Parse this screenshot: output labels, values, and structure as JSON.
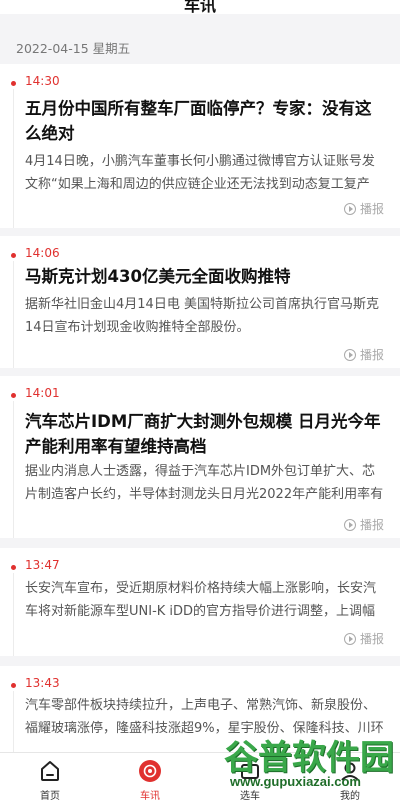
{
  "header": {
    "title": "车讯"
  },
  "date_label": "2022-04-15 星期五",
  "share_label": "播报",
  "news": [
    {
      "time": "14:30",
      "headline": "五月份中国所有整车厂面临停产？专家：没有这么绝对",
      "summary": "4月14日晚，小鹏汽车董事长何小鹏通过微博官方认证账号发文称“如果上海和周边的供应链企业还无法找到动态复工复产"
    },
    {
      "time": "14:06",
      "headline": "马斯克计划430亿美元全面收购推特",
      "summary": "据新华社旧金山4月14日电 美国特斯拉公司首席执行官马斯克14日宣布计划现金收购推特全部股份。"
    },
    {
      "time": "14:01",
      "headline": "汽车芯片IDM厂商扩大封测外包规模 日月光今年产能利用率有望维持高档",
      "summary": "据业内消息人士透露，得益于汽车芯片IDM外包订单扩大、芯片制造客户长约，半导体封测龙头日月光2022年产能利用率有"
    },
    {
      "time": "13:47",
      "headline": "",
      "summary": "长安汽车宣布，受近期原材料价格持续大幅上涨影响，长安汽车将对新能源车型UNI-K iDD的官方指导价进行调整，上调幅"
    },
    {
      "time": "13:43",
      "headline": "",
      "summary": "汽车零部件板块持续拉升，上声电子、常熟汽饰、新泉股份、福耀玻璃涨停，隆盛科技涨超9%，星宇股份、保隆科技、川环"
    }
  ],
  "tabs": [
    {
      "label": "首页",
      "icon": "home-icon",
      "active": false
    },
    {
      "label": "车讯",
      "icon": "news-icon",
      "active": true
    },
    {
      "label": "选车",
      "icon": "car-icon",
      "active": false
    },
    {
      "label": "我的",
      "icon": "profile-icon",
      "active": false
    }
  ],
  "watermark": {
    "main": "谷普软件园",
    "sub": "www.gupuxiazai.com"
  },
  "colors": {
    "accent": "#e0312f",
    "background": "#f4f4f6"
  }
}
